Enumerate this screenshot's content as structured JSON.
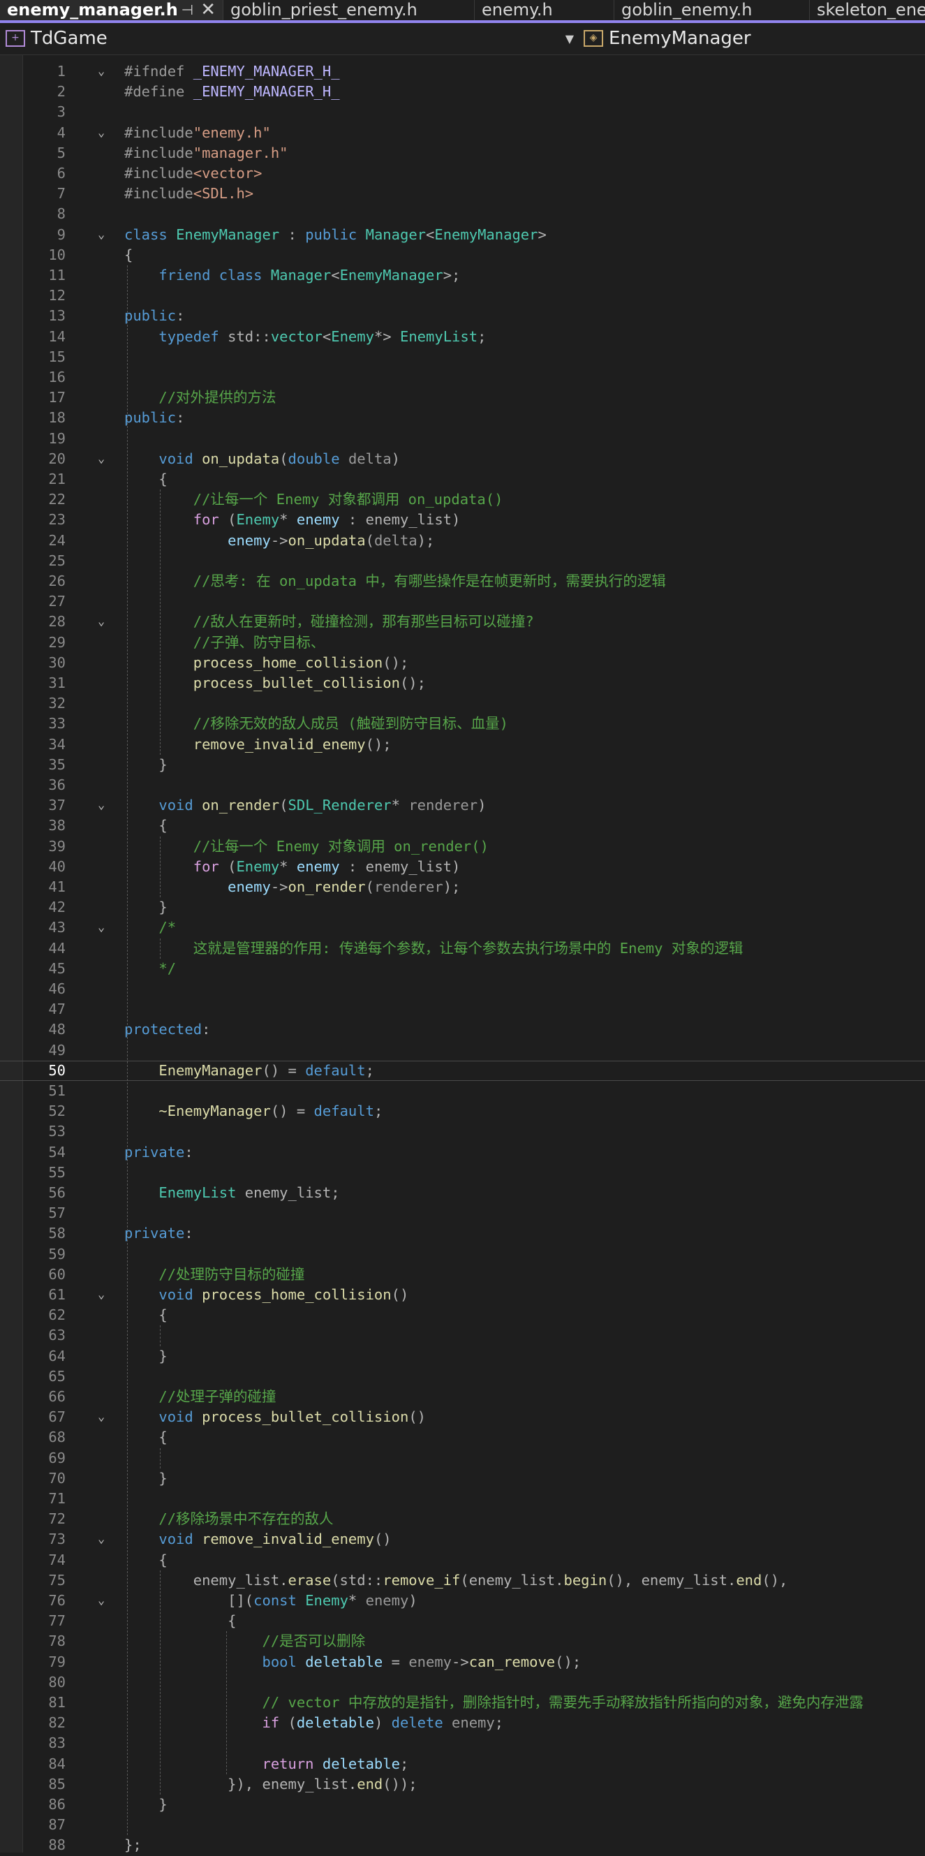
{
  "tabs": [
    {
      "label": "enemy_manager.h",
      "active": true,
      "pin": "⊣",
      "close": "✕"
    },
    {
      "label": "goblin_priest_enemy.h",
      "active": false
    },
    {
      "label": "enemy.h",
      "active": false
    },
    {
      "label": "goblin_enemy.h",
      "active": false
    },
    {
      "label": "skeleton_enemy.h",
      "active": false
    }
  ],
  "nav": {
    "project": "TdGame",
    "scope": "EnemyManager",
    "project_icon": "project-icon",
    "scope_icon": "class-icon"
  },
  "current_line": 50,
  "lines": [
    {
      "n": 1,
      "fold": true,
      "toks": [
        [
          "pp",
          "#ifndef "
        ],
        [
          "mac",
          "_ENEMY_MANAGER_H_"
        ]
      ]
    },
    {
      "n": 2,
      "toks": [
        [
          "pp",
          "#define "
        ],
        [
          "mac",
          "_ENEMY_MANAGER_H_"
        ]
      ]
    },
    {
      "n": 3,
      "toks": []
    },
    {
      "n": 4,
      "fold": true,
      "toks": [
        [
          "pp",
          "#include"
        ],
        [
          "str",
          "\"enemy.h\""
        ]
      ]
    },
    {
      "n": 5,
      "toks": [
        [
          "pp",
          "#include"
        ],
        [
          "str",
          "\"manager.h\""
        ]
      ]
    },
    {
      "n": 6,
      "toks": [
        [
          "pp",
          "#include"
        ],
        [
          "str",
          "<vector>"
        ]
      ]
    },
    {
      "n": 7,
      "toks": [
        [
          "pp",
          "#include"
        ],
        [
          "str",
          "<SDL.h>"
        ]
      ]
    },
    {
      "n": 8,
      "toks": []
    },
    {
      "n": 9,
      "fold": true,
      "toks": [
        [
          "kw",
          "class "
        ],
        [
          "typ",
          "EnemyManager"
        ],
        [
          "pun",
          " : "
        ],
        [
          "kw",
          "public "
        ],
        [
          "typ",
          "Manager"
        ],
        [
          "pun",
          "<"
        ],
        [
          "typ",
          "EnemyManager"
        ],
        [
          "pun",
          ">"
        ]
      ]
    },
    {
      "n": 10,
      "toks": [
        [
          "pun",
          "{"
        ]
      ]
    },
    {
      "n": 11,
      "toks": [
        [
          "",
          ""
        ],
        [
          "kw",
          "    friend class "
        ],
        [
          "typ",
          "Manager"
        ],
        [
          "pun",
          "<"
        ],
        [
          "typ",
          "EnemyManager"
        ],
        [
          "pun",
          ">;"
        ]
      ]
    },
    {
      "n": 12,
      "toks": []
    },
    {
      "n": 13,
      "toks": [
        [
          "kw",
          "public"
        ],
        [
          "pun",
          ":"
        ]
      ]
    },
    {
      "n": 14,
      "toks": [
        [
          "kw",
          "    typedef "
        ],
        [
          "pun",
          "std::"
        ],
        [
          "typ",
          "vector"
        ],
        [
          "pun",
          "<"
        ],
        [
          "typ",
          "Enemy"
        ],
        [
          "pun",
          "*> "
        ],
        [
          "typ",
          "EnemyList"
        ],
        [
          "pun",
          ";"
        ]
      ]
    },
    {
      "n": 15,
      "toks": []
    },
    {
      "n": 16,
      "toks": []
    },
    {
      "n": 17,
      "toks": [
        [
          "cm",
          "    //对外提供的方法"
        ]
      ]
    },
    {
      "n": 18,
      "toks": [
        [
          "kw",
          "public"
        ],
        [
          "pun",
          ":"
        ]
      ]
    },
    {
      "n": 19,
      "toks": []
    },
    {
      "n": 20,
      "fold": true,
      "toks": [
        [
          "kw",
          "    void "
        ],
        [
          "fn",
          "on_updata"
        ],
        [
          "pun",
          "("
        ],
        [
          "kw",
          "double "
        ],
        [
          "par",
          "delta"
        ],
        [
          "pun",
          ")"
        ]
      ]
    },
    {
      "n": 21,
      "toks": [
        [
          "pun",
          "    {"
        ]
      ]
    },
    {
      "n": 22,
      "toks": [
        [
          "cm",
          "        //让每一个 Enemy 对象都调用 on_updata()"
        ]
      ]
    },
    {
      "n": 23,
      "toks": [
        [
          "ctl",
          "        for "
        ],
        [
          "pun",
          "("
        ],
        [
          "typ",
          "Enemy"
        ],
        [
          "pun",
          "* "
        ],
        [
          "var",
          "enemy"
        ],
        [
          "pun",
          " : enemy_list)"
        ]
      ]
    },
    {
      "n": 24,
      "toks": [
        [
          "var",
          "            enemy"
        ],
        [
          "pun",
          "->"
        ],
        [
          "fn",
          "on_updata"
        ],
        [
          "pun",
          "("
        ],
        [
          "par",
          "delta"
        ],
        [
          "pun",
          ");"
        ]
      ]
    },
    {
      "n": 25,
      "toks": []
    },
    {
      "n": 26,
      "toks": [
        [
          "cm",
          "        //思考: 在 on_updata 中，有哪些操作是在帧更新时，需要执行的逻辑"
        ]
      ]
    },
    {
      "n": 27,
      "toks": []
    },
    {
      "n": 28,
      "fold": true,
      "toks": [
        [
          "cm",
          "        //敌人在更新时，碰撞检测，那有那些目标可以碰撞?"
        ]
      ]
    },
    {
      "n": 29,
      "toks": [
        [
          "cm",
          "        //子弹、防守目标、"
        ]
      ]
    },
    {
      "n": 30,
      "toks": [
        [
          "fn",
          "        process_home_collision"
        ],
        [
          "pun",
          "();"
        ]
      ]
    },
    {
      "n": 31,
      "toks": [
        [
          "fn",
          "        process_bullet_collision"
        ],
        [
          "pun",
          "();"
        ]
      ]
    },
    {
      "n": 32,
      "toks": []
    },
    {
      "n": 33,
      "toks": [
        [
          "cm",
          "        //移除无效的敌人成员 (触碰到防守目标、血量)"
        ]
      ]
    },
    {
      "n": 34,
      "toks": [
        [
          "fn",
          "        remove_invalid_enemy"
        ],
        [
          "pun",
          "();"
        ]
      ]
    },
    {
      "n": 35,
      "toks": [
        [
          "pun",
          "    }"
        ]
      ]
    },
    {
      "n": 36,
      "toks": []
    },
    {
      "n": 37,
      "fold": true,
      "toks": [
        [
          "kw",
          "    void "
        ],
        [
          "fn",
          "on_render"
        ],
        [
          "pun",
          "("
        ],
        [
          "typ",
          "SDL_Renderer"
        ],
        [
          "pun",
          "* "
        ],
        [
          "par",
          "renderer"
        ],
        [
          "pun",
          ")"
        ]
      ]
    },
    {
      "n": 38,
      "toks": [
        [
          "pun",
          "    {"
        ]
      ]
    },
    {
      "n": 39,
      "toks": [
        [
          "cm",
          "        //让每一个 Enemy 对象调用 on_render()"
        ]
      ]
    },
    {
      "n": 40,
      "toks": [
        [
          "ctl",
          "        for "
        ],
        [
          "pun",
          "("
        ],
        [
          "typ",
          "Enemy"
        ],
        [
          "pun",
          "* "
        ],
        [
          "var",
          "enemy"
        ],
        [
          "pun",
          " : enemy_list)"
        ]
      ]
    },
    {
      "n": 41,
      "toks": [
        [
          "var",
          "            enemy"
        ],
        [
          "pun",
          "->"
        ],
        [
          "fn",
          "on_render"
        ],
        [
          "pun",
          "("
        ],
        [
          "par",
          "renderer"
        ],
        [
          "pun",
          ");"
        ]
      ]
    },
    {
      "n": 42,
      "toks": [
        [
          "pun",
          "    }"
        ]
      ]
    },
    {
      "n": 43,
      "fold": true,
      "toks": [
        [
          "cm",
          "    /*"
        ]
      ]
    },
    {
      "n": 44,
      "toks": [
        [
          "cm",
          "        这就是管理器的作用: 传递每个参数，让每个参数去执行场景中的 Enemy 对象的逻辑"
        ]
      ]
    },
    {
      "n": 45,
      "toks": [
        [
          "cm",
          "    */"
        ]
      ]
    },
    {
      "n": 46,
      "toks": []
    },
    {
      "n": 47,
      "toks": []
    },
    {
      "n": 48,
      "toks": [
        [
          "kw",
          "protected"
        ],
        [
          "pun",
          ":"
        ]
      ]
    },
    {
      "n": 49,
      "toks": []
    },
    {
      "n": 50,
      "toks": [
        [
          "fn",
          "    EnemyManager"
        ],
        [
          "pun",
          "() = "
        ],
        [
          "kw",
          "default"
        ],
        [
          "pun",
          ";"
        ]
      ]
    },
    {
      "n": 51,
      "toks": []
    },
    {
      "n": 52,
      "toks": [
        [
          "fn",
          "    ~EnemyManager"
        ],
        [
          "pun",
          "() = "
        ],
        [
          "kw",
          "default"
        ],
        [
          "pun",
          ";"
        ]
      ]
    },
    {
      "n": 53,
      "toks": []
    },
    {
      "n": 54,
      "toks": [
        [
          "kw",
          "private"
        ],
        [
          "pun",
          ":"
        ]
      ]
    },
    {
      "n": 55,
      "toks": []
    },
    {
      "n": 56,
      "toks": [
        [
          "typ",
          "    EnemyList "
        ],
        [
          "pun",
          "enemy_list;"
        ]
      ]
    },
    {
      "n": 57,
      "toks": []
    },
    {
      "n": 58,
      "toks": [
        [
          "kw",
          "private"
        ],
        [
          "pun",
          ":"
        ]
      ]
    },
    {
      "n": 59,
      "toks": []
    },
    {
      "n": 60,
      "toks": [
        [
          "cm",
          "    //处理防守目标的碰撞"
        ]
      ]
    },
    {
      "n": 61,
      "fold": true,
      "toks": [
        [
          "kw",
          "    void "
        ],
        [
          "fn",
          "process_home_collision"
        ],
        [
          "pun",
          "()"
        ]
      ]
    },
    {
      "n": 62,
      "toks": [
        [
          "pun",
          "    {"
        ]
      ]
    },
    {
      "n": 63,
      "toks": []
    },
    {
      "n": 64,
      "toks": [
        [
          "pun",
          "    }"
        ]
      ]
    },
    {
      "n": 65,
      "toks": []
    },
    {
      "n": 66,
      "toks": [
        [
          "cm",
          "    //处理子弹的碰撞"
        ]
      ]
    },
    {
      "n": 67,
      "fold": true,
      "toks": [
        [
          "kw",
          "    void "
        ],
        [
          "fn",
          "process_bullet_collision"
        ],
        [
          "pun",
          "()"
        ]
      ]
    },
    {
      "n": 68,
      "toks": [
        [
          "pun",
          "    {"
        ]
      ]
    },
    {
      "n": 69,
      "toks": []
    },
    {
      "n": 70,
      "toks": [
        [
          "pun",
          "    }"
        ]
      ]
    },
    {
      "n": 71,
      "toks": []
    },
    {
      "n": 72,
      "toks": [
        [
          "cm",
          "    //移除场景中不存在的敌人"
        ]
      ]
    },
    {
      "n": 73,
      "fold": true,
      "toks": [
        [
          "kw",
          "    void "
        ],
        [
          "fn",
          "remove_invalid_enemy"
        ],
        [
          "pun",
          "()"
        ]
      ]
    },
    {
      "n": 74,
      "toks": [
        [
          "pun",
          "    {"
        ]
      ]
    },
    {
      "n": 75,
      "toks": [
        [
          "pun",
          "        enemy_list."
        ],
        [
          "fn",
          "erase"
        ],
        [
          "pun",
          "(std::"
        ],
        [
          "fn",
          "remove_if"
        ],
        [
          "pun",
          "(enemy_list."
        ],
        [
          "fn",
          "begin"
        ],
        [
          "pun",
          "(), enemy_list."
        ],
        [
          "fn",
          "end"
        ],
        [
          "pun",
          "(),"
        ]
      ]
    },
    {
      "n": 76,
      "fold": true,
      "toks": [
        [
          "pun",
          "            []("
        ],
        [
          "kw",
          "const "
        ],
        [
          "typ",
          "Enemy"
        ],
        [
          "pun",
          "* "
        ],
        [
          "par",
          "enemy"
        ],
        [
          "pun",
          ")"
        ]
      ]
    },
    {
      "n": 77,
      "toks": [
        [
          "pun",
          "            {"
        ]
      ]
    },
    {
      "n": 78,
      "toks": [
        [
          "cm",
          "                //是否可以删除"
        ]
      ]
    },
    {
      "n": 79,
      "toks": [
        [
          "kw",
          "                bool "
        ],
        [
          "var",
          "deletable"
        ],
        [
          "pun",
          " = "
        ],
        [
          "par",
          "enemy"
        ],
        [
          "pun",
          "->"
        ],
        [
          "fn",
          "can_remove"
        ],
        [
          "pun",
          "();"
        ]
      ]
    },
    {
      "n": 80,
      "toks": []
    },
    {
      "n": 81,
      "toks": [
        [
          "cm",
          "                // vector 中存放的是指针，删除指针时，需要先手动释放指针所指向的对象，避免内存泄露"
        ]
      ]
    },
    {
      "n": 82,
      "toks": [
        [
          "ctl",
          "                if "
        ],
        [
          "pun",
          "("
        ],
        [
          "var",
          "deletable"
        ],
        [
          "pun",
          ") "
        ],
        [
          "kw",
          "delete "
        ],
        [
          "par",
          "enemy"
        ],
        [
          "pun",
          ";"
        ]
      ]
    },
    {
      "n": 83,
      "toks": []
    },
    {
      "n": 84,
      "toks": [
        [
          "ctl",
          "                return "
        ],
        [
          "var",
          "deletable"
        ],
        [
          "pun",
          ";"
        ]
      ]
    },
    {
      "n": 85,
      "toks": [
        [
          "pun",
          "            }), enemy_list."
        ],
        [
          "fn",
          "end"
        ],
        [
          "pun",
          "());"
        ]
      ]
    },
    {
      "n": 86,
      "toks": [
        [
          "pun",
          "    }"
        ]
      ]
    },
    {
      "n": 87,
      "toks": []
    },
    {
      "n": 88,
      "toks": [
        [
          "pun",
          "};"
        ]
      ]
    }
  ]
}
